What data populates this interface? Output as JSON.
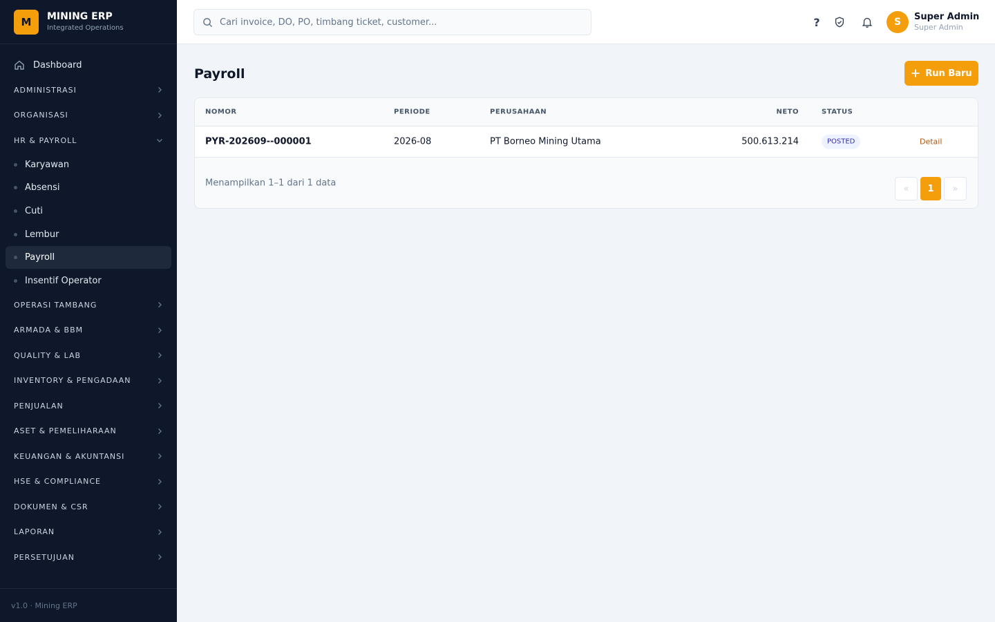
{
  "brand": {
    "logo_letter": "M",
    "name": "MINING ERP",
    "subtitle": "Integrated Operations"
  },
  "sidebar": {
    "dashboard_label": "Dashboard",
    "sections_top": [
      {
        "label": "ADMINISTRASI"
      },
      {
        "label": "ORGANISASI"
      }
    ],
    "hr_section": {
      "label": "HR & PAYROLL",
      "items": [
        {
          "label": "Karyawan"
        },
        {
          "label": "Absensi"
        },
        {
          "label": "Cuti"
        },
        {
          "label": "Lembur"
        },
        {
          "label": "Payroll"
        },
        {
          "label": "Insentif Operator"
        }
      ]
    },
    "sections_bottom": [
      {
        "label": "OPERASI TAMBANG"
      },
      {
        "label": "ARMADA & BBM"
      },
      {
        "label": "QUALITY & LAB"
      },
      {
        "label": "INVENTORY & PENGADAAN"
      },
      {
        "label": "PENJUALAN"
      },
      {
        "label": "ASET & PEMELIHARAAN"
      },
      {
        "label": "KEUANGAN & AKUNTANSI"
      },
      {
        "label": "HSE & COMPLIANCE"
      },
      {
        "label": "DOKUMEN & CSR"
      },
      {
        "label": "LAPORAN"
      },
      {
        "label": "PERSETUJUAN"
      }
    ],
    "footer": "v1.0 · Mining ERP"
  },
  "topbar": {
    "search_placeholder": "Cari invoice, DO, PO, timbang ticket, customer...",
    "help_glyph": "?",
    "user": {
      "initial": "S",
      "name": "Super Admin",
      "role": "Super Admin"
    }
  },
  "page": {
    "title": "Payroll",
    "run_button_label": "Run Baru"
  },
  "table": {
    "headers": {
      "nomor": "NOMOR",
      "periode": "PERIODE",
      "perusahaan": "PERUSAHAAN",
      "neto": "NETO",
      "status": "STATUS"
    },
    "rows": [
      {
        "nomor": "PYR-202609--000001",
        "periode": "2026-08",
        "perusahaan": "PT Borneo Mining Utama",
        "neto": "500.613.214",
        "status": "POSTED",
        "action": "Detail"
      }
    ],
    "footer_text": "Menampilkan 1–1 dari 1 data",
    "pagination": {
      "prev": "«",
      "current": "1",
      "next": "»"
    }
  },
  "colors": {
    "accent": "#f59e0b",
    "sidebar_bg": "#0f172a",
    "badge_bg": "#eef2ff",
    "badge_text": "#3730a3"
  },
  "active_item": "Payroll"
}
